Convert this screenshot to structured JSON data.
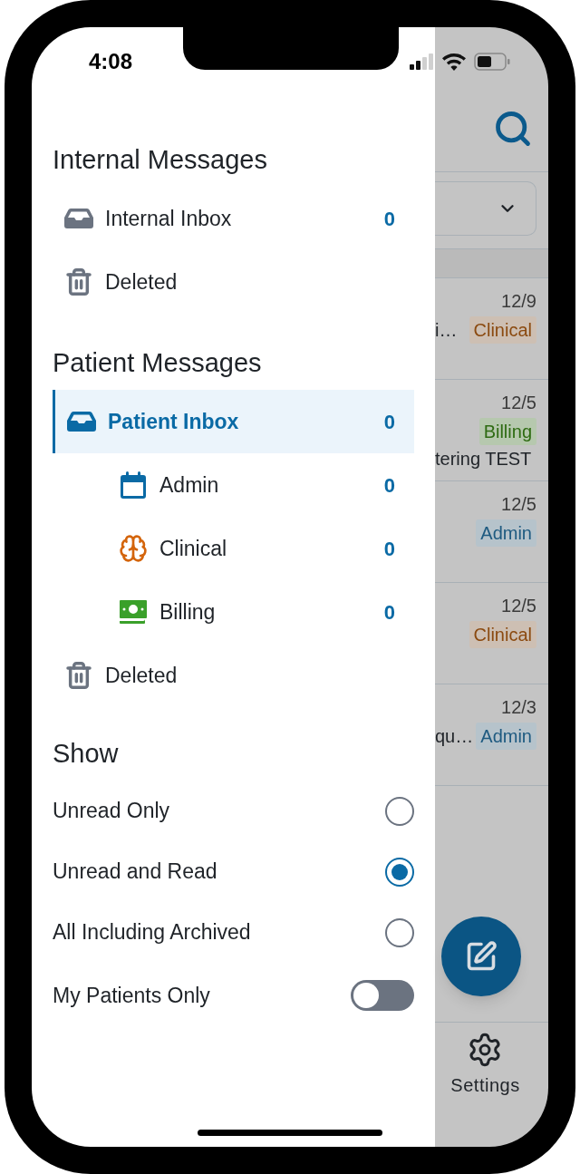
{
  "status_bar": {
    "time": "4:08"
  },
  "drawer": {
    "sections": [
      {
        "title": "Internal Messages",
        "items": [
          {
            "kind": "inbox",
            "label": "Internal Inbox",
            "count": "0",
            "selected": false
          },
          {
            "kind": "trash",
            "label": "Deleted",
            "selected": false
          }
        ]
      },
      {
        "title": "Patient Messages",
        "items": [
          {
            "kind": "inbox",
            "label": "Patient Inbox",
            "count": "0",
            "selected": true,
            "children": [
              {
                "kind": "calendar",
                "label": "Admin",
                "count": "0",
                "selected": false
              },
              {
                "kind": "brain",
                "label": "Clinical",
                "count": "0",
                "selected": false
              },
              {
                "kind": "cash",
                "label": "Billing",
                "count": "0",
                "selected": false
              }
            ]
          },
          {
            "kind": "trash",
            "label": "Deleted",
            "selected": false
          }
        ]
      }
    ],
    "show": {
      "title": "Show",
      "options": [
        {
          "label": "Unread Only",
          "selected": false
        },
        {
          "label": "Unread and Read",
          "selected": true
        },
        {
          "label": "All Including Archived",
          "selected": false
        }
      ],
      "toggle": {
        "label": "My Patients Only",
        "on": false
      }
    }
  },
  "background": {
    "messages": [
      {
        "date": "12/9",
        "snippet": "i…",
        "tag": {
          "kind": "clinical",
          "label": "Clinical"
        }
      },
      {
        "date": "12/5",
        "tag": {
          "kind": "billing",
          "label": "Billing"
        },
        "snippet_below": "tering TEST"
      },
      {
        "date": "12/5",
        "tag": {
          "kind": "admin",
          "label": "Admin"
        }
      },
      {
        "date": "12/5",
        "tag": {
          "kind": "clinical",
          "label": "Clinical"
        }
      },
      {
        "date": "12/3",
        "snippet": "qu…",
        "tag": {
          "kind": "admin",
          "label": "Admin"
        }
      }
    ],
    "nav": {
      "label": "Settings"
    }
  }
}
